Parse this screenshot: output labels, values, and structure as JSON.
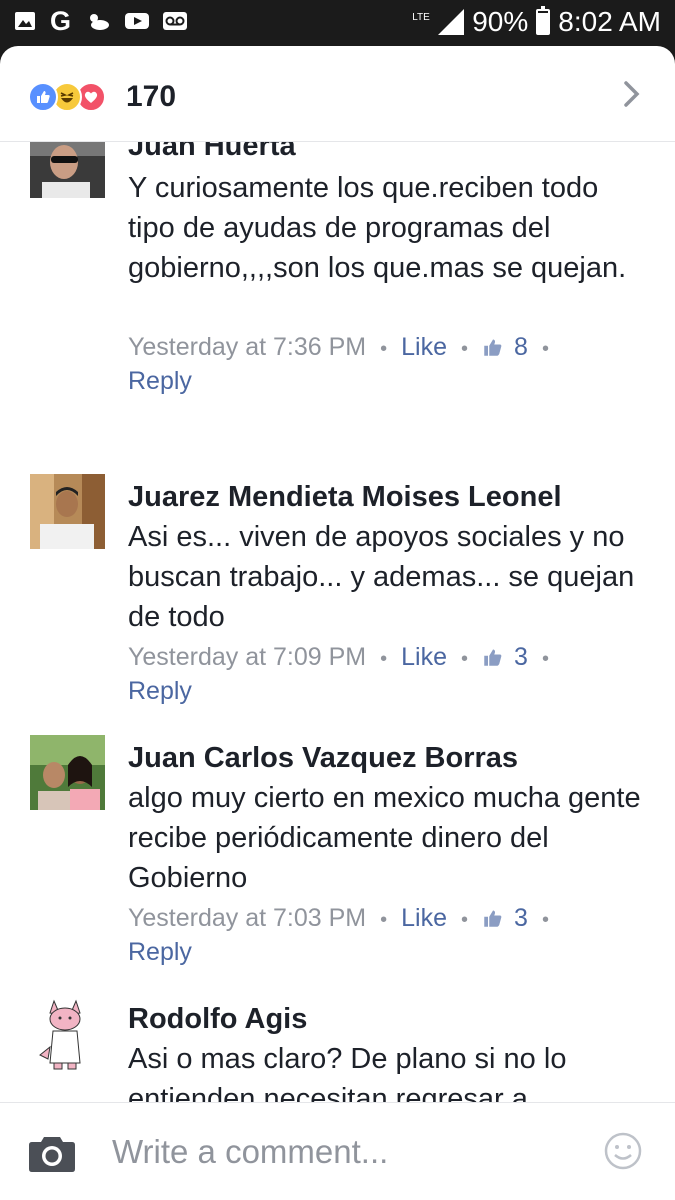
{
  "status_bar": {
    "network": "LTE",
    "battery": "90%",
    "battery_level": 0.9,
    "time": "8:02 AM",
    "icons": [
      "gallery-icon",
      "google-icon",
      "weather-icon",
      "youtube-icon",
      "voicemail-icon"
    ]
  },
  "reactions": {
    "count": "170",
    "icons": [
      "like-reaction-icon",
      "haha-reaction-icon",
      "love-reaction-icon"
    ]
  },
  "comments": [
    {
      "name": "Juan Huerta",
      "text": "Y curiosamente los que.reciben todo tipo de ayudas de programas del gobierno,,,,son los que.mas se quejan.",
      "time": "Yesterday at 7:36 PM",
      "like_label": "Like",
      "like_count": "8",
      "reply_label": "Reply"
    },
    {
      "name": "Juarez Mendieta Moises Leonel",
      "text": "Asi es... viven de apoyos sociales y no buscan trabajo... y ademas... se quejan de todo",
      "time": "Yesterday at 7:09 PM",
      "like_label": "Like",
      "like_count": "3",
      "reply_label": "Reply"
    },
    {
      "name": "Juan Carlos Vazquez Borras",
      "text": "algo muy cierto en mexico mucha gente recibe periódicamente dinero del Gobierno",
      "time": "Yesterday at 7:03 PM",
      "like_label": "Like",
      "like_count": "3",
      "reply_label": "Reply"
    },
    {
      "name": "Rodolfo Agis",
      "text": "Asi o mas claro? De plano si no lo entienden necesitan regresar a maternal!!!"
    }
  ],
  "composer": {
    "placeholder": "Write a comment..."
  },
  "colors": {
    "accent": "#4b67a1",
    "name_text": "#1d2129",
    "meta_text": "#90949c",
    "like_reaction": "#5890ff",
    "love_reaction": "#f25268",
    "haha_reaction": "#f7c93b"
  }
}
